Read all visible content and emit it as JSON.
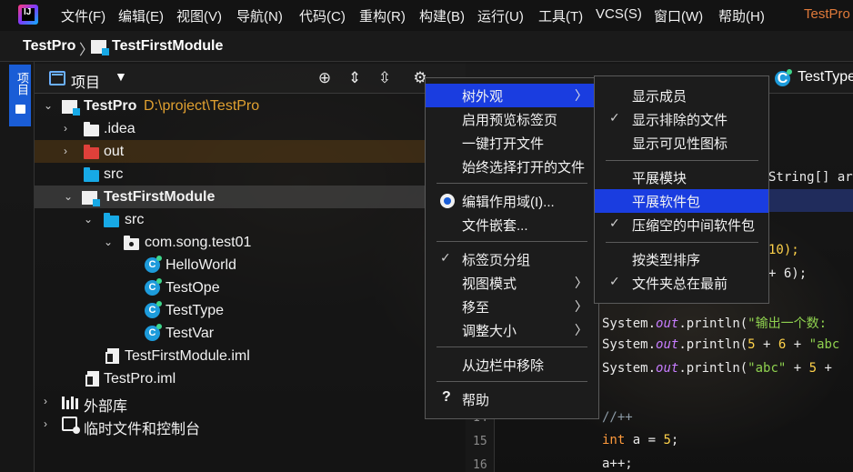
{
  "app": {
    "logo_text": "IJ",
    "window_title": "TestPro",
    "menu": [
      "文件(F)",
      "编辑(E)",
      "视图(V)",
      "导航(N)",
      "代码(C)",
      "重构(R)",
      "构建(B)",
      "运行(U)",
      "工具(T)",
      "VCS(S)",
      "窗口(W)",
      "帮助(H)"
    ]
  },
  "breadcrumb": {
    "project": "TestPro",
    "separator": "〉",
    "module": "TestFirstModule"
  },
  "toolstrip": {
    "project_tab": "项目"
  },
  "panel": {
    "title": "项目",
    "dropdown": "▼"
  },
  "tree": {
    "root_label": "TestPro",
    "root_path": "D:\\project\\TestPro",
    "idea": ".idea",
    "out": "out",
    "src": "src",
    "module": "TestFirstModule",
    "module_src": "src",
    "package": "com.song.test01",
    "classes": [
      "HelloWorld",
      "TestOpe",
      "TestType",
      "TestVar"
    ],
    "module_iml": "TestFirstModule.iml",
    "project_iml": "TestPro.iml",
    "external_libs": "外部库",
    "scratches": "临时文件和控制台"
  },
  "editor": {
    "active_tab": "TestType",
    "tab_icon_letter": "C",
    "code_lines": {
      "l_main": "String[] ar",
      "l_a": "10);",
      "l_b": "+ 6);",
      "l1_pre": "System.",
      "l1_out": "out",
      "l1_post": ".println(",
      "l1_str": "\"输出一个数:",
      "l2_pre": "System.",
      "l2_out": "out",
      "l2_post": ".println(",
      "l2_num1": "5",
      "l2_op": " + ",
      "l2_num2": "6",
      "l2_op2": " + ",
      "l2_str": "\"abc",
      "l3_pre": "System.",
      "l3_out": "out",
      "l3_post": ".println(",
      "l3_str": "\"abc\"",
      "l3_op": " + ",
      "l3_num": "5",
      "l3_tail": " +",
      "comment": "//++",
      "l15_kw": "int",
      "l15_var": " a",
      "l15_eq": " = ",
      "l15_num": "5",
      "l15_end": ";",
      "l16": "a++;"
    },
    "line_numbers": [
      "14",
      "15",
      "16"
    ]
  },
  "context_menu": {
    "items": [
      {
        "label": "树外观",
        "submenu": true
      },
      {
        "label": "启用预览标签页"
      },
      {
        "label": "一键打开文件"
      },
      {
        "label": "始终选择打开的文件"
      },
      {
        "label": "编辑作用域(I)..."
      },
      {
        "label": "文件嵌套..."
      },
      {
        "label": "标签页分组",
        "checked": "✓"
      },
      {
        "label": "视图模式",
        "submenu": true
      },
      {
        "label": "移至",
        "submenu": true
      },
      {
        "label": "调整大小",
        "submenu": true
      },
      {
        "label": "从边栏中移除"
      },
      {
        "label": "帮助",
        "icon": "?"
      }
    ],
    "submenu_arrow": "〉"
  },
  "submenu": {
    "items": [
      {
        "label": "显示成员"
      },
      {
        "label": "显示排除的文件",
        "checked": "✓"
      },
      {
        "label": "显示可见性图标"
      },
      {
        "label": "平展模块"
      },
      {
        "label": "平展软件包"
      },
      {
        "label": "压缩空的中间软件包",
        "checked": "✓"
      },
      {
        "label": "按类型排序"
      },
      {
        "label": "文件夹总在最前",
        "checked": "✓"
      }
    ]
  },
  "colors": {
    "selection": "#1a3de0",
    "accent_blue": "#1d9bdb",
    "path_orange": "#e0a030",
    "title_orange": "#e07a3a"
  }
}
